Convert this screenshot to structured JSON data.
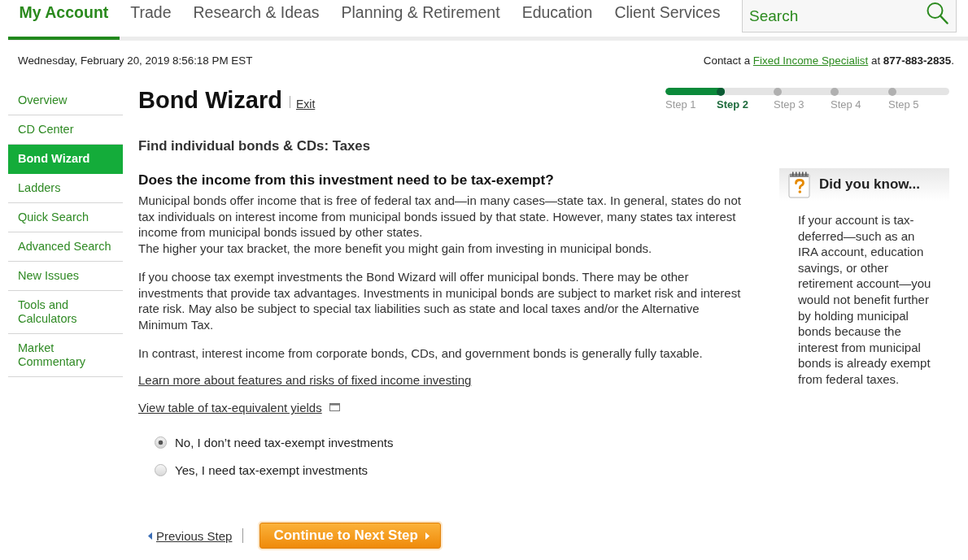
{
  "top_nav": {
    "tabs": [
      {
        "label": "My Account",
        "selected": true
      },
      {
        "label": "Trade",
        "selected": false
      },
      {
        "label": "Research & Ideas",
        "selected": false
      },
      {
        "label": "Planning & Retirement",
        "selected": false
      },
      {
        "label": "Education",
        "selected": false
      },
      {
        "label": "Client Services",
        "selected": false
      }
    ],
    "search": {
      "placeholder": "Search"
    }
  },
  "info_bar": {
    "date": "Wednesday, February 20, 2019 8:56:18 PM EST",
    "contact": {
      "text_before": "Contact a",
      "link": "Fixed Income Specialist",
      "text_after": "at **877-883-2835**."
    }
  },
  "sidebar": {
    "items": [
      {
        "label": "Overview",
        "selected": false
      },
      {
        "label": "CD Center",
        "selected": false
      },
      {
        "label": "Bond Wizard",
        "selected": true
      },
      {
        "label": "Ladders",
        "selected": false
      },
      {
        "label": "Quick Search",
        "selected": false
      },
      {
        "label": "Advanced Search",
        "selected": false
      },
      {
        "label": "New Issues",
        "selected": false
      },
      {
        "label": "Tools and Calculators",
        "selected": false
      },
      {
        "label": "Market Commentary",
        "selected": false
      }
    ]
  },
  "wizard": {
    "title": "Bond Wizard",
    "exit_link": "Exit",
    "progress": {
      "level": 0.21
    },
    "steps": [
      {
        "label": "Step 1",
        "selected": false
      },
      {
        "label": "Step 2",
        "selected": true
      },
      {
        "label": "Step 3",
        "selected": false
      },
      {
        "label": "Step 4",
        "selected": false
      },
      {
        "label": "Step 5",
        "selected": false
      }
    ],
    "page_heading": "Find individual bonds & CDs: Taxes"
  },
  "question": {
    "heading": "Does the income from this investment need to be tax-exempt?",
    "paragraphs": [
      [
        "Municipal bonds offer income that is free of federal tax and—in many cases—state tax. In general, states do not tax individuals on interest income from municipal bonds issued by that state. However, many states tax interest income from municipal bonds issued by other states.",
        "The higher your tax bracket, the more benefit you might gain from investing in municipal bonds."
      ],
      [
        "If you choose tax exempt investments the Bond Wizard will offer municipal bonds. There may be other investments that provide tax advantages. Investments in municipal bonds are subject to market risk and interest rate risk. May also be subject to special tax liabilities such as state and local taxes and/or the Alternative Minimum Tax."
      ],
      [
        "In contrast, interest income from corporate bonds, CDs, and government bonds is generally fully taxable."
      ]
    ],
    "links": [
      {
        "label": "Learn more about features and risks of fixed income investing",
        "kind": "plain"
      },
      {
        "label": "View table of tax-equivalent yields",
        "kind": "popup"
      }
    ],
    "options": [
      {
        "label": "No, I don’t need tax-exempt investments",
        "selected": true
      },
      {
        "label": "Yes, I need tax-exempt investments",
        "selected": false
      }
    ]
  },
  "tip": {
    "title": "Did you know...",
    "body": "If your account is tax-deferred—such as an IRA account, education savings, or other retirement account—you would not benefit further by holding municipal bonds because the interest from municipal bonds is already exempt from federal taxes."
  },
  "footer": {
    "previous": "Previous Step",
    "next": "Continue to Next Step"
  }
}
